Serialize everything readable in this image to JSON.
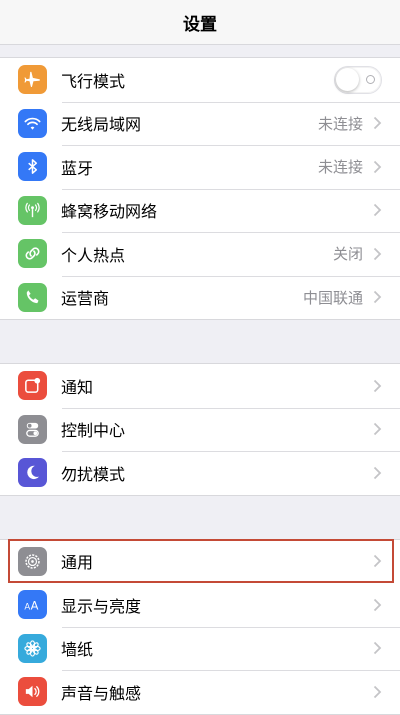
{
  "nav": {
    "title": "设置"
  },
  "group1": [
    {
      "name": "airplane-mode",
      "icon": "airplane-icon",
      "color": "#f09a37",
      "label": "飞行模式",
      "value": "",
      "toggle": true,
      "toggle_on": false
    },
    {
      "name": "wifi",
      "icon": "wifi-icon",
      "color": "#3478f6",
      "label": "无线局域网",
      "value": "未连接"
    },
    {
      "name": "bluetooth",
      "icon": "bluetooth-icon",
      "color": "#3478f6",
      "label": "蓝牙",
      "value": "未连接"
    },
    {
      "name": "cellular",
      "icon": "cellular-antenna-icon",
      "color": "#65c466",
      "label": "蜂窝移动网络",
      "value": ""
    },
    {
      "name": "hotspot",
      "icon": "hotspot-link-icon",
      "color": "#65c466",
      "label": "个人热点",
      "value": "关闭"
    },
    {
      "name": "carrier",
      "icon": "phone-icon",
      "color": "#65c466",
      "label": "运营商",
      "value": "中国联通"
    }
  ],
  "group2": [
    {
      "name": "notifications",
      "icon": "notifications-icon",
      "color": "#eb4d3d",
      "label": "通知",
      "value": ""
    },
    {
      "name": "control-center",
      "icon": "control-center-icon",
      "color": "#8e8e93",
      "label": "控制中心",
      "value": ""
    },
    {
      "name": "do-not-disturb",
      "icon": "moon-icon",
      "color": "#5856d6",
      "label": "勿扰模式",
      "value": ""
    }
  ],
  "group3": [
    {
      "name": "general",
      "icon": "gear-icon",
      "color": "#8e8e93",
      "label": "通用",
      "value": "",
      "highlighted": true,
      "highlight_color": "#c44a36"
    },
    {
      "name": "display-brightness",
      "icon": "text-size-icon",
      "color": "#3478f6",
      "label": "显示与亮度",
      "value": ""
    },
    {
      "name": "wallpaper",
      "icon": "wallpaper-flower-icon",
      "color": "#36aadc",
      "label": "墙纸",
      "value": ""
    },
    {
      "name": "sounds-haptics",
      "icon": "speaker-icon",
      "color": "#eb4d3d",
      "label": "声音与触感",
      "value": ""
    }
  ]
}
